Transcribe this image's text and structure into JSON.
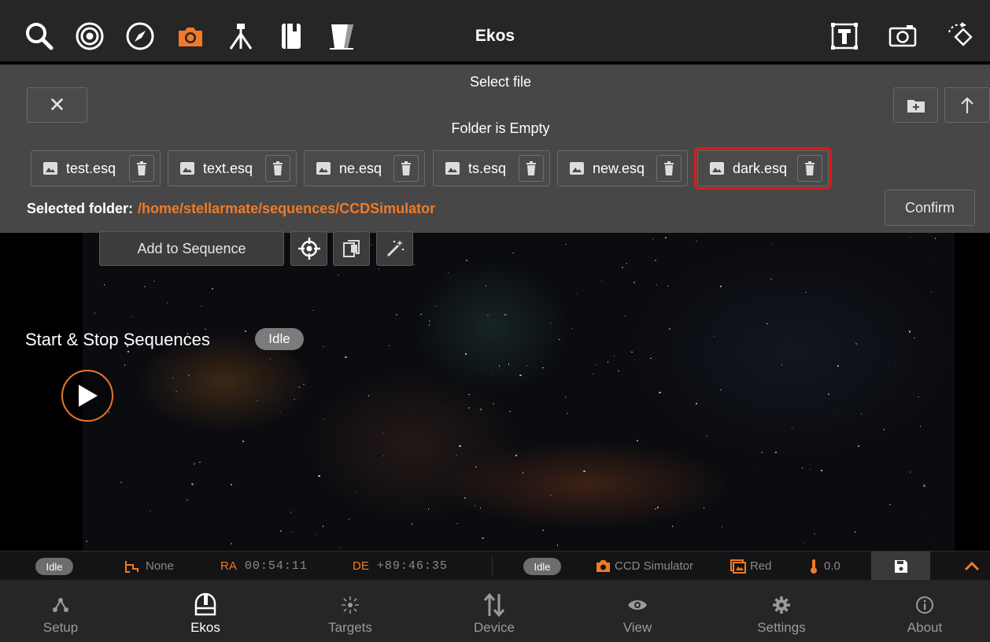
{
  "header": {
    "title": "Ekos",
    "tools": [
      {
        "icon": "search-icon"
      },
      {
        "icon": "target-icon"
      },
      {
        "icon": "compass-icon"
      },
      {
        "icon": "camera-icon",
        "active": true
      },
      {
        "icon": "tripod-icon"
      },
      {
        "icon": "notebook-icon"
      },
      {
        "icon": "flat-panel-icon"
      }
    ],
    "right_tools": [
      {
        "icon": "text-frame-icon"
      },
      {
        "icon": "screenshot-icon"
      },
      {
        "icon": "rotate-icon"
      }
    ]
  },
  "dialog": {
    "title": "Select file",
    "subtitle": "Folder is Empty",
    "close_label": "✕",
    "files": [
      {
        "name": "test.esq"
      },
      {
        "name": "text.esq"
      },
      {
        "name": "ne.esq"
      },
      {
        "name": "ts.esq"
      },
      {
        "name": "new.esq"
      },
      {
        "name": "dark.esq",
        "highlighted": true
      }
    ],
    "selected_folder_label": "Selected folder:",
    "selected_folder_path": "/home/stellarmate/sequences/CCDSimulator",
    "confirm_label": "Confirm"
  },
  "capture": {
    "add_to_sequence_label": "Add to Sequence",
    "section_title": "Start & Stop Sequences",
    "status": "Idle"
  },
  "statusbar": {
    "mount_status": "Idle",
    "tracking": "None",
    "ra_label": "RA",
    "ra_value": "00:54:11",
    "de_label": "DE",
    "de_value": "+89:46:35",
    "camera_status": "Idle",
    "camera_name": "CCD Simulator",
    "filter": "Red",
    "temperature": "0.0"
  },
  "nav": {
    "items": [
      {
        "label": "Setup",
        "icon": "setup-icon"
      },
      {
        "label": "Ekos",
        "icon": "ekos-icon",
        "active": true
      },
      {
        "label": "Targets",
        "icon": "targets-icon"
      },
      {
        "label": "Device",
        "icon": "device-icon"
      },
      {
        "label": "View",
        "icon": "view-icon"
      },
      {
        "label": "Settings",
        "icon": "settings-icon"
      },
      {
        "label": "About",
        "icon": "about-icon"
      }
    ]
  },
  "colors": {
    "accent": "#f07a28",
    "highlight": "#e01818",
    "panel": "#474747",
    "bar": "#262626"
  }
}
